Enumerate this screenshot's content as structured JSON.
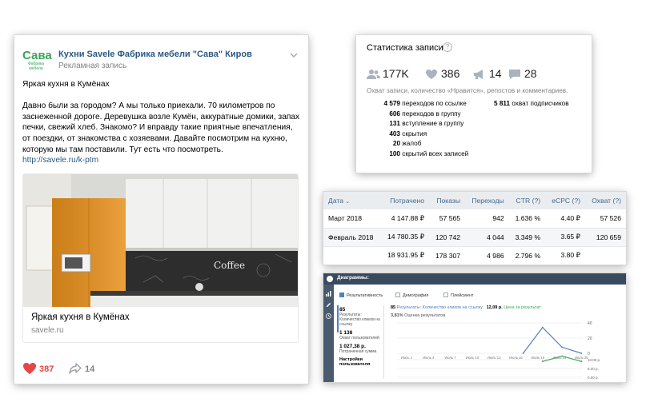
{
  "post": {
    "logo_main": "Сава",
    "logo_sub": "Фабрика мебели",
    "author": "Кухни Savele Фабрика мебели \"Сава\" Киров",
    "ad_label": "Рекламная запись",
    "paragraph1": "Яркая кухня в Кумёнах",
    "paragraph2": "Давно были за городом? А мы только приехали. 70 километров по заснеженной дороге. Деревушка возле Кумён, аккуратные домики, запах печки, свежий хлеб. Знакомо? И вправду такие приятные впечатления, от поездки, от знакомства с хозяевами. Давайте посмотрим на кухню, которую мы там поставили. Тут есть что посмотреть.",
    "link": "http://savele.ru/k-ptm",
    "attachment_title": "Яркая кухня в Кумёнах",
    "attachment_domain": "savele.ru",
    "likes": "387",
    "shares": "14",
    "image_text": "Coffee"
  },
  "stats": {
    "title": "Статистика записи",
    "help": "?",
    "reach": "177K",
    "likes": "386",
    "reposts": "14",
    "comments": "28",
    "description": "Охват записи, количество «Нравится», репостов и комментариев.",
    "left_rows": [
      {
        "value": "4 579",
        "label": "переходов по ссылке"
      },
      {
        "value": "606",
        "label": "переходов в группу"
      },
      {
        "value": "131",
        "label": "вступление в группу"
      },
      {
        "value": "403",
        "label": "скрытия"
      },
      {
        "value": "20",
        "label": "жалоб"
      },
      {
        "value": "100",
        "label": "скрытий всех записей"
      }
    ],
    "right_rows": [
      {
        "value": "5 811",
        "label": "охват подписчиков"
      }
    ]
  },
  "table": {
    "headers": [
      "Дата",
      "Потрачено",
      "Показы",
      "Переходы",
      "CTR (?)",
      "eCPC (?)",
      "Охват (?)"
    ],
    "rows": [
      [
        "Март 2018",
        "4 147.88 ₽",
        "57 565",
        "942",
        "1.636 %",
        "4.40 ₽",
        "57 526"
      ],
      [
        "Февраль 2018",
        "14 780.35 ₽",
        "120 742",
        "4 044",
        "3.349 %",
        "3.65 ₽",
        "120 659"
      ],
      [
        "",
        "18 931.95 ₽",
        "178 307",
        "4 986",
        "2.796 %",
        "3.80 ₽",
        ""
      ]
    ]
  },
  "diagram": {
    "title": "Диаграммы:",
    "tabs": [
      "Результативность",
      "Демография",
      "Плейсмент"
    ],
    "left_metrics": [
      {
        "value": "85",
        "label": "Результаты: Количество кликов на ссылку"
      },
      {
        "value": "1 138",
        "label": "Охват пользователей"
      },
      {
        "value": "1 027,38 р.",
        "label": "Потраченная сумма"
      }
    ],
    "settings_label": "Настройки пользователя",
    "caption_value": "85",
    "caption_label": "Результаты: Количество кликов на ссылку",
    "caption_cost": "12,09 р.",
    "caption_cost_label": "Цена за результат",
    "sub_value": "3,81%",
    "sub_label": "Оценка результатов"
  },
  "chart_data": {
    "type": "line",
    "title": "",
    "x": [
      "Июль 1",
      "Июль 4",
      "Июль 7",
      "Июль 10",
      "Июль 13",
      "Июль 16",
      "Июль 19",
      "Июль 22",
      "Июль 25"
    ],
    "y_ticks": [
      "40",
      "20",
      "0"
    ],
    "y2_ticks": [
      "10.00 р.",
      "5.00 р.",
      "0.00 р."
    ],
    "series": [
      {
        "values": [
          null,
          null,
          null,
          null,
          null,
          null,
          0,
          34,
          8,
          0
        ]
      },
      {
        "values": [
          null,
          null,
          null,
          null,
          null,
          null,
          null,
          9,
          12,
          9
        ]
      }
    ],
    "colors": [
      "#5181b8",
      "#3aa35a"
    ],
    "grid": true
  }
}
